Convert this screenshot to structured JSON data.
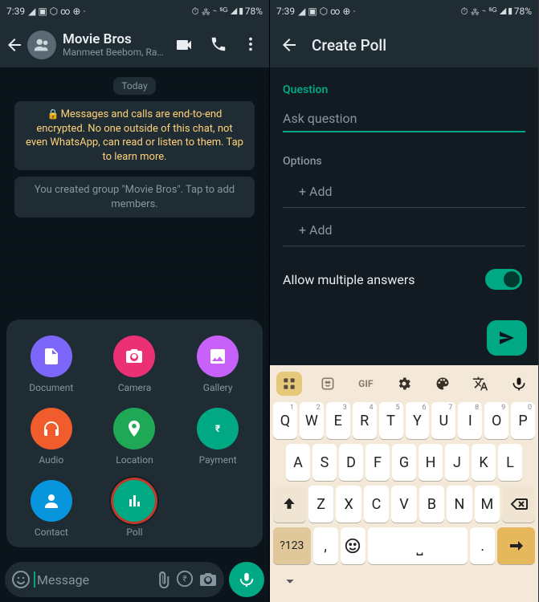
{
  "status": {
    "time": "7:39",
    "left_icons": "◢ ▣ ⬡ ∞ ⊕ ·",
    "right_icons": "⏱ ⁂ ⌁ ⁵ᴳ ◢▮78%"
  },
  "chat": {
    "title": "Movie Bros",
    "subtitle": "Manmeet Beebom, Ramji...",
    "date_chip": "Today",
    "encryption_msg": "Messages and calls are end-to-end encrypted. No one outside of this chat, not even WhatsApp, can read or listen to them. Tap to learn more.",
    "group_created_msg": "You created group \"Movie Bros\". Tap to add members.",
    "input_placeholder": "Message"
  },
  "attach": {
    "document": "Document",
    "camera": "Camera",
    "gallery": "Gallery",
    "audio": "Audio",
    "location": "Location",
    "payment": "Payment",
    "contact": "Contact",
    "poll": "Poll"
  },
  "poll": {
    "title": "Create Poll",
    "question_label": "Question",
    "question_placeholder": "Ask question",
    "options_label": "Options",
    "add_label": "+ Add",
    "allow_multiple": "Allow multiple answers"
  },
  "kbd": {
    "gif": "GIF",
    "row1": [
      "Q",
      "W",
      "E",
      "R",
      "T",
      "Y",
      "U",
      "I",
      "O",
      "P"
    ],
    "row1sup": [
      "1",
      "2",
      "3",
      "4",
      "5",
      "6",
      "7",
      "8",
      "9",
      "0"
    ],
    "row2": [
      "A",
      "S",
      "D",
      "F",
      "G",
      "H",
      "J",
      "K",
      "L"
    ],
    "row3": [
      "Z",
      "X",
      "C",
      "V",
      "B",
      "N",
      "M"
    ],
    "numkey": "?123",
    "comma": ",",
    "period": "."
  },
  "colors": {
    "document": "#7d66fa",
    "camera": "#ec3074",
    "gallery": "#c861fa",
    "audio": "#f15c2c",
    "location": "#1fa855",
    "payment": "#00a884",
    "contact": "#0795dc",
    "poll": "#00a884"
  }
}
